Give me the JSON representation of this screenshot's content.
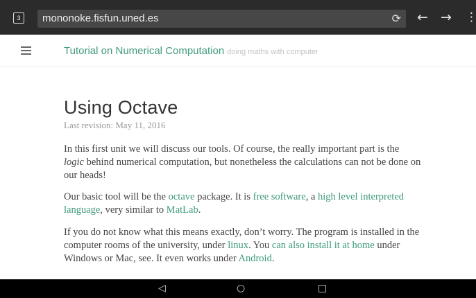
{
  "browser": {
    "tab_count": "3",
    "url": "mononoke.fisfun.uned.es"
  },
  "site": {
    "title": "Tutorial on Numerical Computation",
    "subtitle": "doing maths with computer"
  },
  "page": {
    "heading": "Using Octave",
    "revision": "Last revision: May 11, 2016",
    "p1": {
      "a": "In this first unit we will discuss our tools. Of course, the really important part is the ",
      "logic": "logic",
      "b": " behind numerical computation, but nonetheless the calculations can not be done on our heads!"
    },
    "p2": {
      "a": "Our basic tool will be the ",
      "link_octave": "octave",
      "b": " package. It is ",
      "link_free_software": "free software",
      "c": ", a ",
      "link_high_level": "high level interpreted language",
      "d": ", very similar to ",
      "link_matlab": "MatLab",
      "e": "."
    },
    "p3": {
      "a": "If you do not know what this means exactly, don’t worry. The program is installed in the computer rooms of the university, under ",
      "link_linux": "linux",
      "b": ". You ",
      "link_can_also": "can also install it at home",
      "c": " under Windows or Mac, see. It even works under ",
      "link_android": "Android",
      "d": "."
    }
  }
}
